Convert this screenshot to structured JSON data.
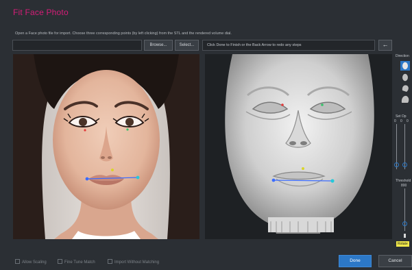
{
  "window": {
    "title": "Fit Face Photo"
  },
  "instructions": "Open a Face photo file for import. Choose three corresponding points (by left clicking) from the STL and the rendered volume dial.",
  "toolbar": {
    "path_value": "",
    "browse_label": "Browse...",
    "select_label": "Select...",
    "status_text": "Click Done to Finish or the Back Arrow to redo any steps",
    "back_glyph": "←"
  },
  "side_panel": {
    "direction_label": "Direction",
    "opacity_label": "Set Op",
    "opacity_ticks": [
      "0",
      "0",
      "0"
    ],
    "threshold_label": "Threshold",
    "threshold_value": "800",
    "rotate_label": "Rotate"
  },
  "options": {
    "allow_scaling": "Allow Scaling",
    "fine_tune_match": "Fine Tune Match",
    "import_without_matching": "Import Without Matching"
  },
  "footer": {
    "done_label": "Done",
    "cancel_label": "Cancel"
  },
  "icons": {
    "back": "left-arrow-icon",
    "views": [
      "head-front-icon",
      "head-side-icon",
      "head-oblique-icon",
      "head-back-icon"
    ]
  },
  "colors": {
    "title": "#d61d78",
    "accent_button": "#2c78c7",
    "rotate_badge": "#f1e94a",
    "landmark_blue": "#3b6cff",
    "landmark_green": "#37c26a",
    "landmark_red": "#e23b3b",
    "landmark_cyan": "#27c9d9",
    "landmark_yellow": "#d9d52a"
  }
}
